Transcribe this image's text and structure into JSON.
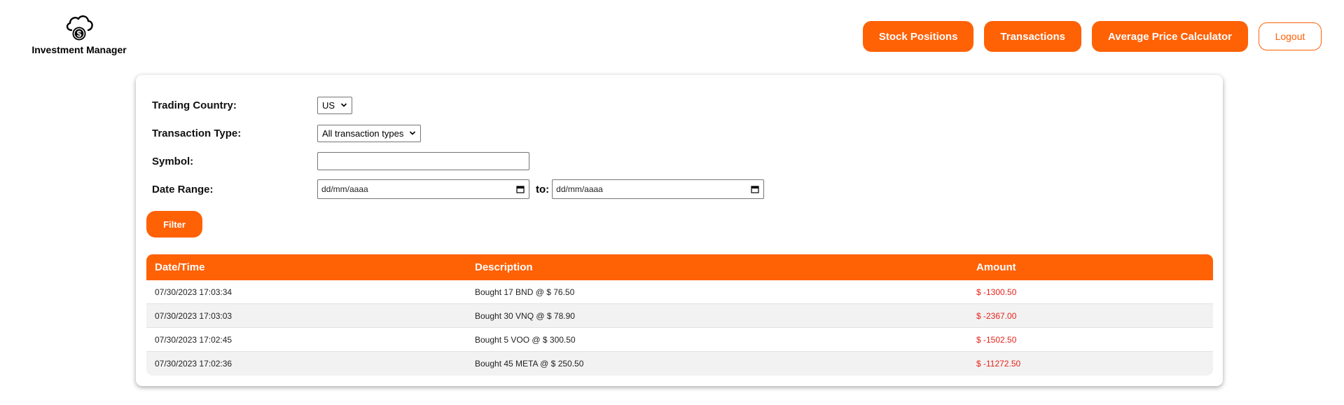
{
  "brand": {
    "name": "Investment Manager",
    "icon": "cloud-dollar-icon"
  },
  "nav": {
    "stock_positions": "Stock Positions",
    "transactions": "Transactions",
    "avg_price_calculator": "Average Price Calculator",
    "logout": "Logout"
  },
  "colors": {
    "accent": "#ff6105",
    "negative": "#e5231b",
    "row_alt": "#f2f2f2"
  },
  "form": {
    "trading_country": {
      "label": "Trading Country:",
      "value": "US"
    },
    "transaction_type": {
      "label": "Transaction Type:",
      "value": "All transaction types"
    },
    "symbol": {
      "label": "Symbol:",
      "value": ""
    },
    "date_range": {
      "label": "Date Range:",
      "from_placeholder": "dd/mm/aaaa",
      "to_label": "to:",
      "to_placeholder": "dd/mm/aaaa"
    },
    "filter_label": "Filter"
  },
  "table": {
    "headers": [
      "Date/Time",
      "Description",
      "Amount"
    ],
    "rows": [
      {
        "datetime": "07/30/2023 17:03:34",
        "description": "Bought 17 BND @ $ 76.50",
        "amount": "$ -1300.50"
      },
      {
        "datetime": "07/30/2023 17:03:03",
        "description": "Bought 30 VNQ @ $ 78.90",
        "amount": "$ -2367.00"
      },
      {
        "datetime": "07/30/2023 17:02:45",
        "description": "Bought 5 VOO @ $ 300.50",
        "amount": "$ -1502.50"
      },
      {
        "datetime": "07/30/2023 17:02:36",
        "description": "Bought 45 META @ $ 250.50",
        "amount": "$ -11272.50"
      }
    ]
  }
}
